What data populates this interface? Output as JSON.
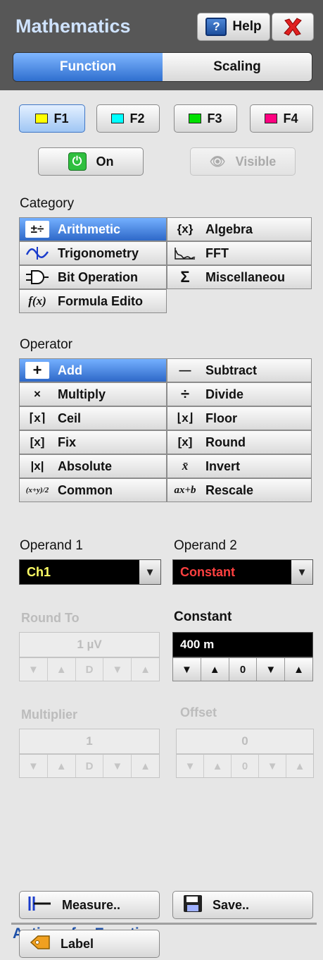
{
  "header": {
    "title": "Mathematics",
    "help_label": "Help",
    "help_icon_char": "?",
    "tabs": [
      {
        "label": "Function",
        "active": true
      },
      {
        "label": "Scaling",
        "active": false
      }
    ]
  },
  "functions": [
    {
      "label": "F1",
      "color": "#ffff00",
      "selected": true
    },
    {
      "label": "F2",
      "color": "#00ffff",
      "selected": false
    },
    {
      "label": "F3",
      "color": "#00e000",
      "selected": false
    },
    {
      "label": "F4",
      "color": "#ff0080",
      "selected": false
    }
  ],
  "power": {
    "on_label": "On",
    "visible_label": "Visible"
  },
  "category": {
    "label": "Category",
    "items": [
      {
        "label": "Arithmetic",
        "icon": "arithmetic-icon",
        "glyph": "±÷",
        "selected": true
      },
      {
        "label": "Algebra",
        "icon": "braces-x-icon",
        "glyph": "{x}",
        "selected": false
      },
      {
        "label": "Trigonometry",
        "icon": "sine-wave-icon",
        "glyph": "∿",
        "selected": false
      },
      {
        "label": "FFT",
        "icon": "spectrum-icon",
        "glyph": "⌇",
        "selected": false
      },
      {
        "label": "Bit Operation",
        "icon": "logic-gate-icon",
        "glyph": "⊃",
        "selected": false
      },
      {
        "label": "Miscellaneou",
        "icon": "sigma-icon",
        "glyph": "Σ",
        "selected": false
      },
      {
        "label": "Formula Edito",
        "icon": "function-icon",
        "glyph": "f(x)",
        "selected": false
      }
    ]
  },
  "operator": {
    "label": "Operator",
    "items": [
      {
        "label": "Add",
        "icon": "plus-icon",
        "glyph": "+",
        "selected": true
      },
      {
        "label": "Subtract",
        "icon": "minus-icon",
        "glyph": "—",
        "selected": false
      },
      {
        "label": "Multiply",
        "icon": "times-icon",
        "glyph": "×",
        "selected": false
      },
      {
        "label": "Divide",
        "icon": "divide-icon",
        "glyph": "÷",
        "selected": false
      },
      {
        "label": "Ceil",
        "icon": "ceil-icon",
        "glyph": "⌈x⌉",
        "selected": false
      },
      {
        "label": "Floor",
        "icon": "floor-icon",
        "glyph": "⌊x⌋",
        "selected": false
      },
      {
        "label": "Fix",
        "icon": "fix-icon",
        "glyph": "[x]",
        "selected": false
      },
      {
        "label": "Round",
        "icon": "round-icon",
        "glyph": "[x]",
        "selected": false
      },
      {
        "label": "Absolute",
        "icon": "absolute-icon",
        "glyph": "|x|",
        "selected": false
      },
      {
        "label": "Invert",
        "icon": "invert-icon",
        "glyph": "x̄",
        "selected": false
      },
      {
        "label": "Common",
        "icon": "common-icon",
        "glyph": "(x+y)/2",
        "selected": false
      },
      {
        "label": "Rescale",
        "icon": "rescale-icon",
        "glyph": "ax+b",
        "selected": false
      }
    ]
  },
  "operand1": {
    "label": "Operand 1",
    "value": "Ch1",
    "value_color": "#ffff66"
  },
  "operand2": {
    "label": "Operand 2",
    "value": "Constant",
    "value_color": "#ff4040"
  },
  "round_to": {
    "label": "Round To",
    "value": "1 µV",
    "digit": "D"
  },
  "constant": {
    "label": "Constant",
    "value": "400 m",
    "digit": "0"
  },
  "multiplier": {
    "label": "Multiplier",
    "value": "1",
    "digit": "D"
  },
  "offset": {
    "label": "Offset",
    "value": "0",
    "digit": "0"
  },
  "actions": {
    "label": "Actions for Function",
    "measure_label": "Measure..",
    "save_label": "Save..",
    "label_label": "Label"
  }
}
